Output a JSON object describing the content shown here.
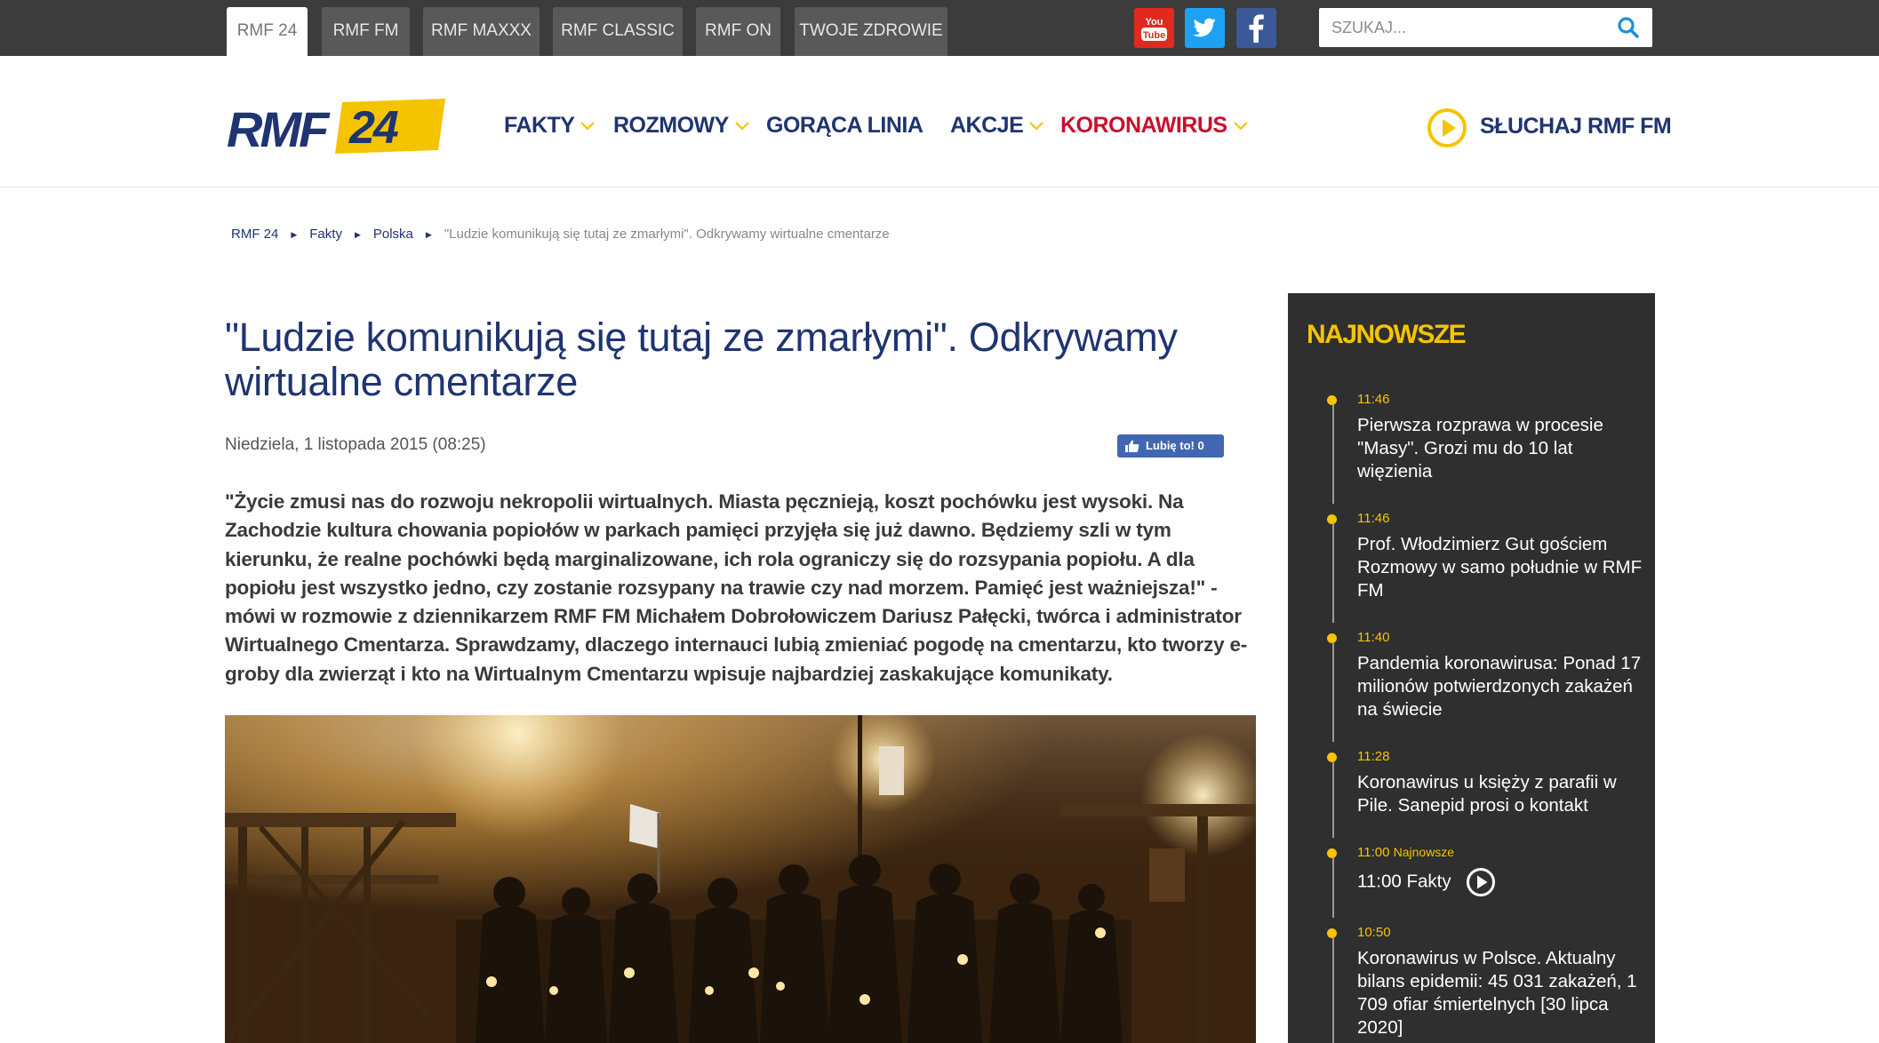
{
  "topbar": {
    "tabs": [
      {
        "label": "RMF 24",
        "active": true
      },
      {
        "label": "RMF FM"
      },
      {
        "label": "RMF MAXXX"
      },
      {
        "label": "RMF CLASSIC"
      },
      {
        "label": "RMF ON"
      },
      {
        "label": "TWOJE ZDROWIE"
      }
    ],
    "social": [
      {
        "icon": "youtube-icon",
        "color": "#e02a20"
      },
      {
        "icon": "twitter-icon",
        "color": "#1da1f2"
      },
      {
        "icon": "facebook-icon",
        "color": "#3b5998"
      }
    ],
    "search": {
      "placeholder": "SZUKAJ...",
      "value": ""
    }
  },
  "logo": {
    "part1": "RMF",
    "part2": "24"
  },
  "nav": {
    "items": [
      {
        "label": "FAKTY",
        "dropdown": true
      },
      {
        "label": "ROZMOWY",
        "dropdown": true
      },
      {
        "label": "GORĄCA LINIA",
        "dropdown": false
      },
      {
        "label": "AKCJE",
        "dropdown": true
      },
      {
        "label": "KORONAWIRUS",
        "dropdown": true,
        "color": "#c8102e"
      }
    ],
    "listen_label": "SŁUCHAJ RMF FM"
  },
  "breadcrumb": [
    "RMF 24",
    "Fakty",
    "Polska",
    "\"Ludzie komunikują się tutaj ze zmarłymi\". Odkrywamy wirtualne cmentarze"
  ],
  "article": {
    "title": "\"Ludzie komunikują się tutaj ze zmarłymi\". Odkrywamy wirtualne cmentarze",
    "date": "Niedziela, 1 listopada 2015 (08:25)",
    "like_label": "Lubię to! 0",
    "lead": "\"Życie zmusi nas do rozwoju nekropolii wirtualnych. Miasta pęcznieją, koszt pochówku jest wysoki. Na Zachodzie kultura chowania popiołów w parkach pamięci przyjęła się już dawno. Będziemy szli w tym kierunku, że realne pochówki będą marginalizowane, ich rola ograniczy się do rozsypania popiołu. A dla popiołu jest wszystko jedno, czy zostanie rozsypany na trawie czy nad morzem. Pamięć jest ważniejsza!\" - mówi w rozmowie z dziennikarzem RMF FM Michałem Dobrołowiczem Dariusz Pałęcki, twórca i administrator Wirtualnego Cmentarza. Sprawdzamy, dlaczego internauci lubią zmieniać pogodę na cmentarzu, kto tworzy e-groby dla zwierząt i kto na Wirtualnym Cmentarzu wpisuje najbardziej zaskakujące komunikaty."
  },
  "sidebar": {
    "heading": "NAJNOWSZE",
    "items": [
      {
        "time": "11:46",
        "text": "Pierwsza rozprawa w procesie \"Masy\". Grozi mu do 10 lat więzienia"
      },
      {
        "time": "11:46",
        "text": "Prof. Włodzimierz Gut gościem Rozmowy w samo południe w RMF FM"
      },
      {
        "time": "11:40",
        "text": "Pandemia koronawirusa: Ponad 17 milionów potwierdzonych zakażeń na świecie"
      },
      {
        "time": "11:28",
        "text": "Koronawirus u księży z parafii w Pile. Sanepid prosi o kontakt"
      },
      {
        "time": "11:00",
        "tag": "Najnowsze",
        "text": "11:00 Fakty"
      },
      {
        "time": "10:50",
        "text": "Koronawirus w Polsce. Aktualny bilans epidemii: 45 031 zakażeń, 1 709 ofiar śmiertelnych [30 lipca 2020]"
      }
    ]
  },
  "colors": {
    "brand_navy": "#1f3471",
    "brand_yellow": "#f5c400",
    "alert_red": "#c8102e",
    "topbar": "#3c3c3c"
  }
}
